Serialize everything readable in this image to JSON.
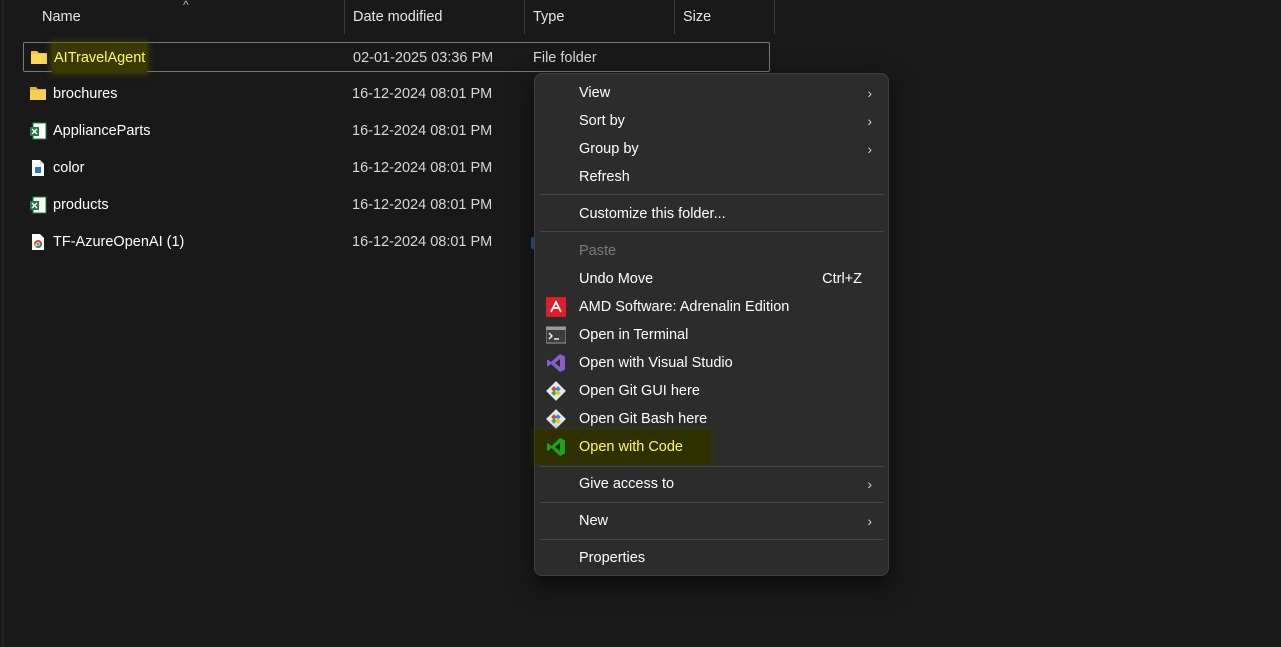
{
  "header": {
    "name": "Name",
    "date": "Date modified",
    "type": "Type",
    "size": "Size",
    "sort_caret": "^"
  },
  "files": [
    {
      "name": "AITravelAgent",
      "date": "02-01-2025 03:36 PM",
      "type": "File folder",
      "icon": "folder-icon"
    },
    {
      "name": "brochures",
      "date": "16-12-2024 08:01 PM",
      "type": "",
      "icon": "folder-icon"
    },
    {
      "name": "ApplianceParts",
      "date": "16-12-2024 08:01 PM",
      "type": "",
      "icon": "excel-file-icon"
    },
    {
      "name": "color",
      "date": "16-12-2024 08:01 PM",
      "type": "",
      "icon": "image-file-icon"
    },
    {
      "name": "products",
      "date": "16-12-2024 08:01 PM",
      "type": "",
      "icon": "excel-file-icon"
    },
    {
      "name": "TF-AzureOpenAI (1)",
      "date": "16-12-2024 08:01 PM",
      "type": "",
      "icon": "chrome-file-icon"
    }
  ],
  "menu": {
    "view": "View",
    "sort_by": "Sort by",
    "group_by": "Group by",
    "refresh": "Refresh",
    "customize": "Customize this folder...",
    "paste": "Paste",
    "undo_move": "Undo Move",
    "undo_shortcut": "Ctrl+Z",
    "amd": "AMD Software: Adrenalin Edition",
    "terminal": "Open in Terminal",
    "visual_studio": "Open with Visual Studio",
    "git_gui": "Open Git GUI here",
    "git_bash": "Open Git Bash here",
    "code": "Open with Code",
    "give_access": "Give access to",
    "new": "New",
    "properties": "Properties",
    "chevron": "›"
  },
  "colors": {
    "background": "#191919",
    "menu_bg": "#2c2c2c",
    "highlight_text": "#ffff5a",
    "folder": "#f3c53a",
    "excel": "#1f7a45",
    "vscode": "#1fa01f",
    "amd": "#d9202a",
    "visual_studio": "#8a5cd0"
  }
}
